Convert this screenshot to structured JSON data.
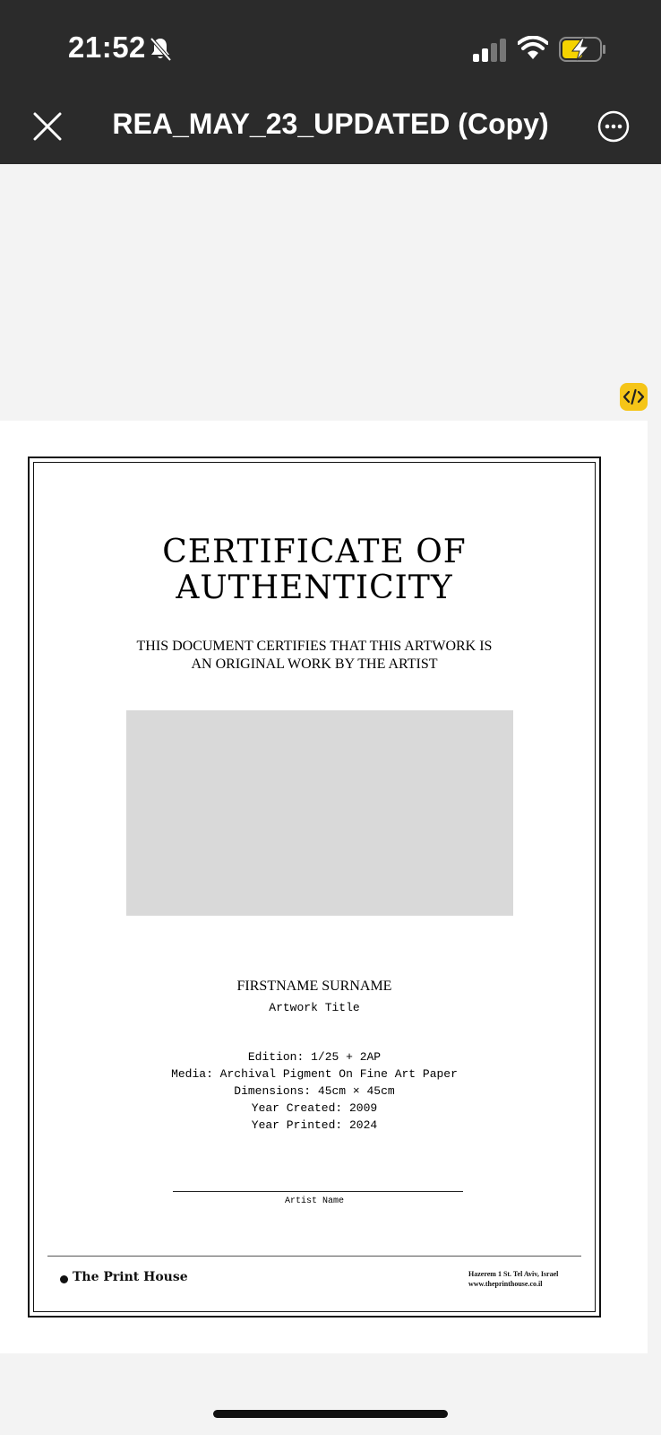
{
  "status_bar": {
    "time": "21:52"
  },
  "header": {
    "title": "REA_MAY_23_UPDATED (Copy)"
  },
  "certificate": {
    "title_line1": "CERTIFICATE OF",
    "title_line2": "AUTHENTICITY",
    "subtitle_line1": "THIS DOCUMENT CERTIFIES THAT THIS ARTWORK IS",
    "subtitle_line2": "AN ORIGINAL WORK BY THE ARTIST",
    "artist_name": "FIRSTNAME SURNAME",
    "artwork_title": "Artwork Title",
    "details": [
      "Edition: 1/25 + 2AP",
      "Media: Archival Pigment On Fine Art Paper",
      "Dimensions: 45cm × 45cm",
      "Year Created: 2009",
      "Year Printed: 2024"
    ],
    "signature_label": "Artist Name",
    "brand": "The Print House",
    "address_line1": "Hazerem 1 St. Tel Aviv, Israel",
    "address_line2": "www.theprinthouse.co.il"
  },
  "icons": {
    "close": "close-icon",
    "more": "more-icon",
    "code": "code-icon",
    "bell": "bell-slash-icon",
    "signal": "signal-icon",
    "wifi": "wifi-icon",
    "battery": "battery-charging-icon"
  },
  "colors": {
    "header_bg": "#2b2b2b",
    "badge": "#f5c518",
    "battery": "#f5d300",
    "placeholder": "#d9d9d9"
  }
}
